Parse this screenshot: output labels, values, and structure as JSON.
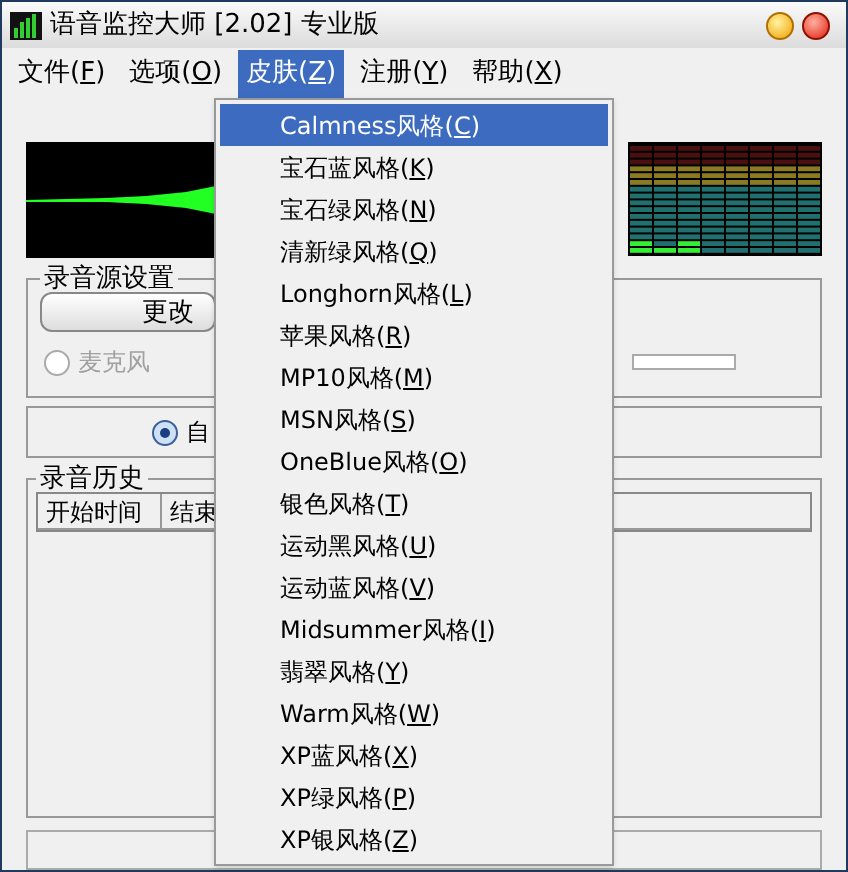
{
  "window": {
    "title": "语音监控大师 [2.02] 专业版"
  },
  "menu_bar": [
    {
      "label": "文件(F)",
      "selected": false
    },
    {
      "label": "选项(O)",
      "selected": false
    },
    {
      "label": "皮肤(Z)",
      "selected": true
    },
    {
      "label": "注册(Y)",
      "selected": false
    },
    {
      "label": "帮助(X)",
      "selected": false
    }
  ],
  "skin_menu": [
    {
      "label": "Calmness风格(C)",
      "selected": true
    },
    {
      "label": "宝石蓝风格(K)",
      "selected": false
    },
    {
      "label": "宝石绿风格(N)",
      "selected": false
    },
    {
      "label": "清新绿风格(Q)",
      "selected": false
    },
    {
      "label": "Longhorn风格(L)",
      "selected": false
    },
    {
      "label": "苹果风格(R)",
      "selected": false
    },
    {
      "label": "MP10风格(M)",
      "selected": false
    },
    {
      "label": "MSN风格(S)",
      "selected": false
    },
    {
      "label": "OneBlue风格(O)",
      "selected": false
    },
    {
      "label": "银色风格(T)",
      "selected": false
    },
    {
      "label": "运动黑风格(U)",
      "selected": false
    },
    {
      "label": "运动蓝风格(V)",
      "selected": false
    },
    {
      "label": "Midsummer风格(I)",
      "selected": false
    },
    {
      "label": "翡翠风格(Y)",
      "selected": false
    },
    {
      "label": "Warm风格(W)",
      "selected": false
    },
    {
      "label": "XP蓝风格(X)",
      "selected": false
    },
    {
      "label": "XP绿风格(P)",
      "selected": false
    },
    {
      "label": "XP银风格(Z)",
      "selected": false
    }
  ],
  "source_group": {
    "title": "录音源设置",
    "button": "更改",
    "radio": {
      "label": "麦克风",
      "selected": false,
      "disabled": true
    }
  },
  "mode_group": {
    "radio": {
      "label": "自",
      "selected": true
    }
  },
  "history_group": {
    "title": "录音历史",
    "columns": [
      "开始时间",
      "结束"
    ]
  }
}
